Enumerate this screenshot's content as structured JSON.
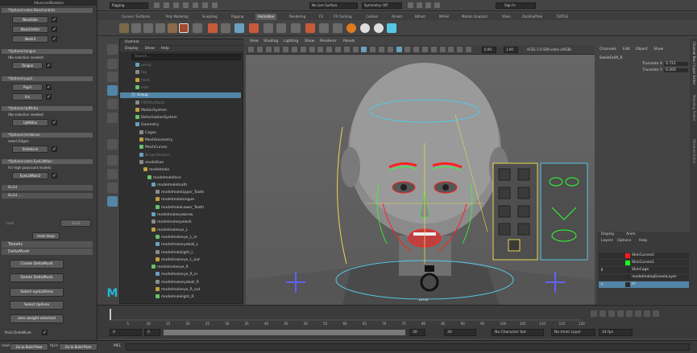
{
  "colors": {
    "accent": "#5285a6",
    "red_curve": "#ff2020",
    "green_curve": "#30ff30",
    "halo": "#57c6e6"
  },
  "left_panel": {
    "title": "AdvancedSkeleton",
    "sections": [
      {
        "header": "*Optional extra NoseControls",
        "buttons": [
          "NoseSide",
          "NoseCenter",
          "Nostril"
        ]
      },
      {
        "header": "*Optional tongue",
        "note": "(No selection needed)",
        "buttons": [
          "Tongue"
        ]
      },
      {
        "header": "*Optional pupil",
        "note": "",
        "buttons": [
          "Pupil",
          "Iris"
        ]
      },
      {
        "header": "*Optional UpMidLo",
        "note": "(No selection needed)",
        "buttons": [
          "UpMidLo"
        ]
      },
      {
        "header": "*Optional SmileLine",
        "note": "select Edges:",
        "buttons": [
          "SmileLine"
        ]
      },
      {
        "header": "*Optional extra EyeLidMain",
        "note": "For high polycount models:",
        "buttons": [
          "EyeLidMain2"
        ]
      }
    ],
    "build_rows": [
      "Build",
      "Build ..."
    ],
    "lock_label": "Lock",
    "build_small": "Build",
    "reset_steps": "reset steps",
    "frames": [
      "Tweaks",
      "DeltaMush"
    ],
    "delta_buttons": [
      "Create DeltaMush",
      "Delete DeltaMush",
      "Select eyeLidArea",
      "Select lipArea",
      "zero weight selected"
    ],
    "paint_label": "Paint DeltaMush:",
    "bottom_ready": "ready",
    "bottom_build_pose": "Go to Build Pose",
    "bottom_face": "face:",
    "bottom_build_pose2": "Go to Build Pose"
  },
  "menubar": {
    "workspace": "Rigging",
    "live_surface": "No Live Surface",
    "symmetry": "Symmetry: Off",
    "sign_in": "Sign In"
  },
  "shelf_tabs": [
    "Curves / Surfaces",
    "Poly Modeling",
    "Sculpting",
    "Rigging",
    "Animation",
    "Rendering",
    "FX",
    "FX Caching",
    "Custom",
    "Arnold",
    "Bifrost",
    "MASH",
    "Motion Graphics",
    "XGen",
    "ZooShelfAdv",
    "TURTLE"
  ],
  "active_shelf_tab": "Animation",
  "outliner": {
    "title": "Outliner",
    "menu": [
      "Display",
      "Show",
      "Help"
    ],
    "search_placeholder": "Search...",
    "rows": [
      {
        "label": "persp",
        "indent": 1,
        "state": "dim"
      },
      {
        "label": "top",
        "indent": 1,
        "state": "dim"
      },
      {
        "label": "front",
        "indent": 1,
        "state": "dim"
      },
      {
        "label": "side",
        "indent": 1,
        "state": "dim"
      },
      {
        "label": "Group",
        "indent": 0,
        "state": "sel"
      },
      {
        "label": "FKOffsetRoot",
        "indent": 1,
        "state": "dim"
      },
      {
        "label": "MotionSystem",
        "indent": 1,
        "state": ""
      },
      {
        "label": "DeformationSystem",
        "indent": 1,
        "state": ""
      },
      {
        "label": "Geometry",
        "indent": 1,
        "state": ""
      },
      {
        "label": "Cages",
        "indent": 2,
        "state": ""
      },
      {
        "label": "MeshGeometry",
        "indent": 2,
        "state": ""
      },
      {
        "label": "MeshCurves",
        "indent": 2,
        "state": ""
      },
      {
        "label": "BrowsShaders",
        "indent": 2,
        "state": "dim"
      },
      {
        "label": "modelGeo",
        "indent": 2,
        "state": ""
      },
      {
        "label": "modelmale",
        "indent": 3,
        "state": ""
      },
      {
        "label": "modelmaleface",
        "indent": 4,
        "state": ""
      },
      {
        "label": "modelmaletooth",
        "indent": 5,
        "state": ""
      },
      {
        "label": "modelmaleUpper_Tooth",
        "indent": 6,
        "state": ""
      },
      {
        "label": "modelmaletongue",
        "indent": 6,
        "state": ""
      },
      {
        "label": "modelmaleLower_Tooth",
        "indent": 6,
        "state": ""
      },
      {
        "label": "modelmaleeyebrow",
        "indent": 5,
        "state": ""
      },
      {
        "label": "modelmaleeyelash",
        "indent": 5,
        "state": ""
      },
      {
        "label": "modelmaleeye_L",
        "indent": 5,
        "state": ""
      },
      {
        "label": "modelmaleeye_L_in",
        "indent": 6,
        "state": ""
      },
      {
        "label": "modelmaleeyeball_L",
        "indent": 6,
        "state": ""
      },
      {
        "label": "modelmalelight_L",
        "indent": 6,
        "state": ""
      },
      {
        "label": "modelmaleeye_L_out",
        "indent": 6,
        "state": ""
      },
      {
        "label": "modelmaleeye_R",
        "indent": 5,
        "state": ""
      },
      {
        "label": "modelmaleeye_R_in",
        "indent": 6,
        "state": ""
      },
      {
        "label": "modelmaleeyeball_R",
        "indent": 6,
        "state": ""
      },
      {
        "label": "modelmaleeye_R_out",
        "indent": 6,
        "state": ""
      },
      {
        "label": "modelmalelight_R",
        "indent": 6,
        "state": ""
      }
    ]
  },
  "viewport": {
    "menu": [
      "View",
      "Shading",
      "Lighting",
      "Show",
      "Renderer",
      "Panels"
    ],
    "near": "0.00",
    "far": "1.00",
    "colorspace": "ACES 1.0 SDR-video (sRGB)",
    "camera_label": "persp"
  },
  "channel_box": {
    "menu": [
      "Channels",
      "Edit",
      "Object",
      "Show"
    ],
    "object": "SmileFollX_R",
    "attrs": [
      {
        "name": "Translate X",
        "value": "0.721"
      },
      {
        "name": "Translate Y",
        "value": "0.200"
      }
    ]
  },
  "side_tabs": [
    "Channel Box / Layer Editor",
    "Modeling Toolkit",
    "Attribute Editor"
  ],
  "layers": {
    "tabs": [
      "Display",
      "Anim"
    ],
    "menu": [
      "Layers",
      "Options",
      "Help"
    ],
    "rows": [
      {
        "name": "SkinCurves2",
        "color": "#ff1a1a",
        "v": "",
        "sel": false
      },
      {
        "name": "SkinCurves1",
        "color": "#1aff1a",
        "v": "",
        "sel": false
      },
      {
        "name": "SkinCage",
        "color": "#2b2b2b",
        "v": "R",
        "sel": false
      },
      {
        "name": "modelmaleqGroomLayer",
        "color": "#2b2b2b",
        "v": "",
        "sel": false
      },
      {
        "name": "Hi",
        "color": "#2b2b2b",
        "v": "V",
        "sel": true
      }
    ]
  },
  "timeline": {
    "ticks": [
      "5",
      "10",
      "15",
      "20",
      "25",
      "30",
      "35",
      "40",
      "45",
      "50",
      "55",
      "60",
      "65",
      "70",
      "75",
      "80",
      "85",
      "90",
      "95",
      "100",
      "105",
      "110",
      "115",
      "120"
    ],
    "current_frame": "0"
  },
  "range_bar": {
    "start": "0",
    "start2": "0",
    "end": "30",
    "end2": "30",
    "char_set": "No Character Set",
    "anim_layer": "No Anim Layer",
    "fps": "24 fps"
  },
  "command_line": {
    "label": "MEL"
  }
}
